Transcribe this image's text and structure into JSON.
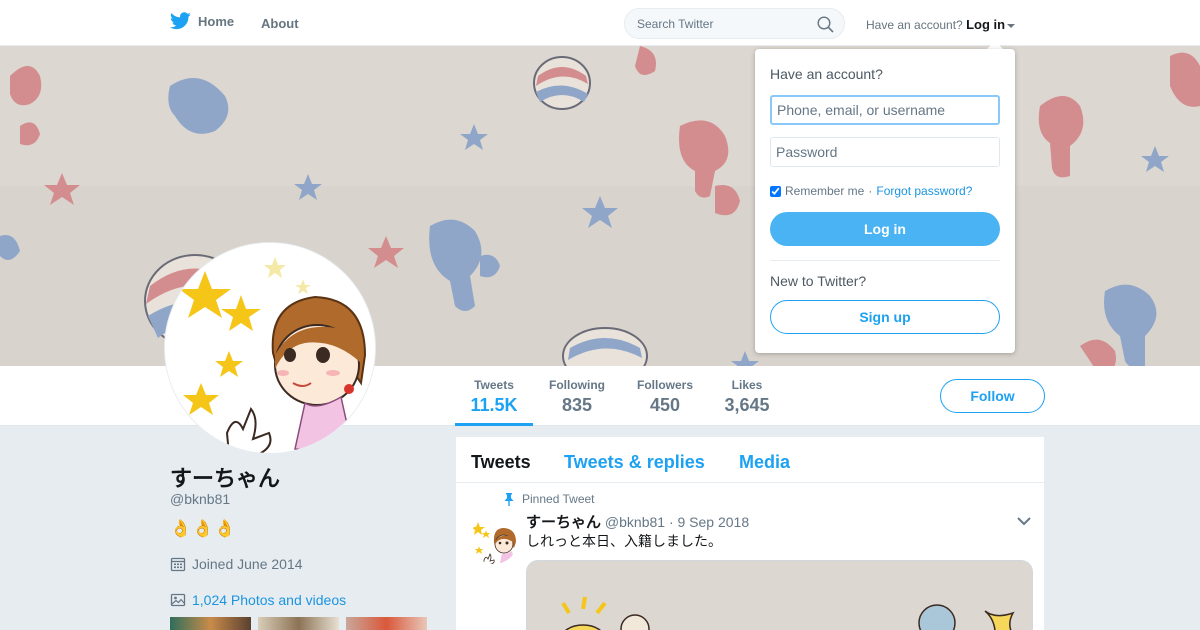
{
  "colors": {
    "accent": "#1da1f2",
    "login_button": "#4ab3f4",
    "link": "#1b95e0"
  },
  "topnav": {
    "home_label": "Home",
    "about_label": "About",
    "search_placeholder": "Search Twitter",
    "have_account_label": "Have an account?",
    "login_label": "Log in"
  },
  "profile": {
    "name": "すーちゃん",
    "handle": "@bknb81",
    "bio": "👌👌👌",
    "joined": "Joined June 2014",
    "photos_link": "1,024 Photos and videos"
  },
  "stats": [
    {
      "label": "Tweets",
      "value": "11.5K"
    },
    {
      "label": "Following",
      "value": "835"
    },
    {
      "label": "Followers",
      "value": "450"
    },
    {
      "label": "Likes",
      "value": "3,645"
    }
  ],
  "follow_label": "Follow",
  "timeline": {
    "tabs": [
      "Tweets",
      "Tweets & replies",
      "Media"
    ],
    "pinned_label": "Pinned Tweet",
    "tweet": {
      "name": "すーちゃん",
      "handle": "@bknb81",
      "date": "· 9 Sep 2018",
      "text": "しれっと本日、入籍しました。"
    }
  },
  "login_dropdown": {
    "title": "Have an account?",
    "username_placeholder": "Phone, email, or username",
    "password_placeholder": "Password",
    "remember_label": "Remember me",
    "separator": "·",
    "forgot_label": "Forgot password?",
    "login_button": "Log in",
    "new_label": "New to Twitter?",
    "signup_button": "Sign up"
  }
}
